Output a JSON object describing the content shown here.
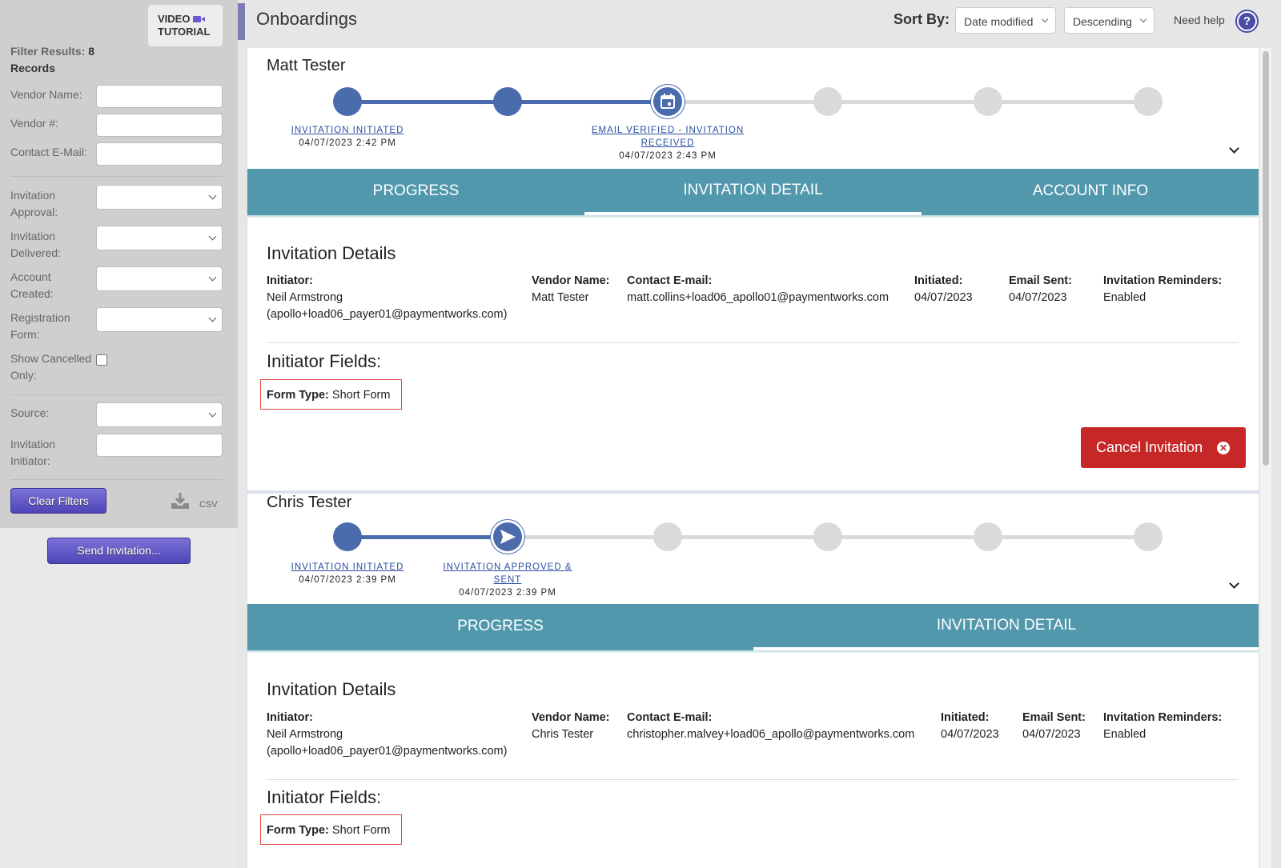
{
  "sidebar": {
    "video_tutorial": "VIDEO",
    "video_tutorial_2": "TUTORIAL",
    "filter_results_label": "Filter Results:",
    "filter_results_count": "8",
    "filter_results_suffix": "Records",
    "fields": {
      "vendor_name": "Vendor Name:",
      "vendor_number": "Vendor #:",
      "contact_email": "Contact E-Mail:",
      "invitation_approval": "Invitation Approval:",
      "invitation_delivered": "Invitation Delivered:",
      "account_created": "Account Created:",
      "registration_form": "Registration Form:",
      "show_cancelled": "Show Cancelled Only:",
      "source": "Source:",
      "invitation_initiator": "Invitation Initiator:"
    },
    "clear_filters": "Clear Filters",
    "csv": "CSV",
    "send_invitation": "Send Invitation..."
  },
  "header": {
    "title": "Onboardings",
    "sort_by": "Sort By:",
    "sort_field": "Date modified",
    "sort_order": "Descending",
    "need_help": "Need help",
    "help_glyph": "?"
  },
  "cards": [
    {
      "name": "Matt Tester",
      "steps": [
        {
          "label": "INVITATION INITIATED",
          "date": "04/07/2023 2:42 PM"
        },
        {
          "label": "EMAIL VERIFIED - INVITATION",
          "label2": "RECEIVED",
          "date": "04/07/2023 2:43 PM"
        }
      ],
      "tabs": [
        "PROGRESS",
        "INVITATION DETAIL",
        "ACCOUNT INFO"
      ],
      "active_tab": "INVITATION DETAIL",
      "details_title": "Invitation Details",
      "initiator_h": "Initiator:",
      "initiator": "Neil Armstrong",
      "initiator_email": "(apollo+load06_payer01@paymentworks.com)",
      "vendor_h": "Vendor Name:",
      "vendor": "Matt Tester",
      "contact_h": "Contact E-mail:",
      "contact": "matt.collins+load06_apollo01@paymentworks.com",
      "initiated_h": "Initiated:",
      "initiated": "04/07/2023",
      "email_sent_h": "Email Sent:",
      "email_sent": "04/07/2023",
      "reminders_h": "Invitation Reminders:",
      "reminders": "Enabled",
      "fields_title": "Initiator Fields:",
      "form_type_h": "Form Type:",
      "form_type": "Short Form",
      "cancel": "Cancel Invitation"
    },
    {
      "name": "Chris Tester",
      "steps": [
        {
          "label": "INVITATION INITIATED",
          "date": "04/07/2023 2:39 PM"
        },
        {
          "label": "INVITATION APPROVED &",
          "label2": "SENT",
          "date": "04/07/2023 2:39 PM"
        }
      ],
      "tabs": [
        "PROGRESS",
        "INVITATION DETAIL"
      ],
      "active_tab": "INVITATION DETAIL",
      "details_title": "Invitation Details",
      "initiator_h": "Initiator:",
      "initiator": "Neil Armstrong",
      "initiator_email": "(apollo+load06_payer01@paymentworks.com)",
      "vendor_h": "Vendor Name:",
      "vendor": "Chris Tester",
      "contact_h": "Contact E-mail:",
      "contact": "christopher.malvey+load06_apollo@paymentworks.com",
      "initiated_h": "Initiated:",
      "initiated": "04/07/2023",
      "email_sent_h": "Email Sent:",
      "email_sent": "04/07/2023",
      "reminders_h": "Invitation Reminders:",
      "reminders": "Enabled",
      "fields_title": "Initiator Fields:",
      "form_type_h": "Form Type:",
      "form_type": "Short Form"
    }
  ],
  "colors": {
    "accent": "#4a6cad",
    "tab_bar": "#5298ac",
    "cancel": "#c62828",
    "button": "#5a50c4"
  }
}
